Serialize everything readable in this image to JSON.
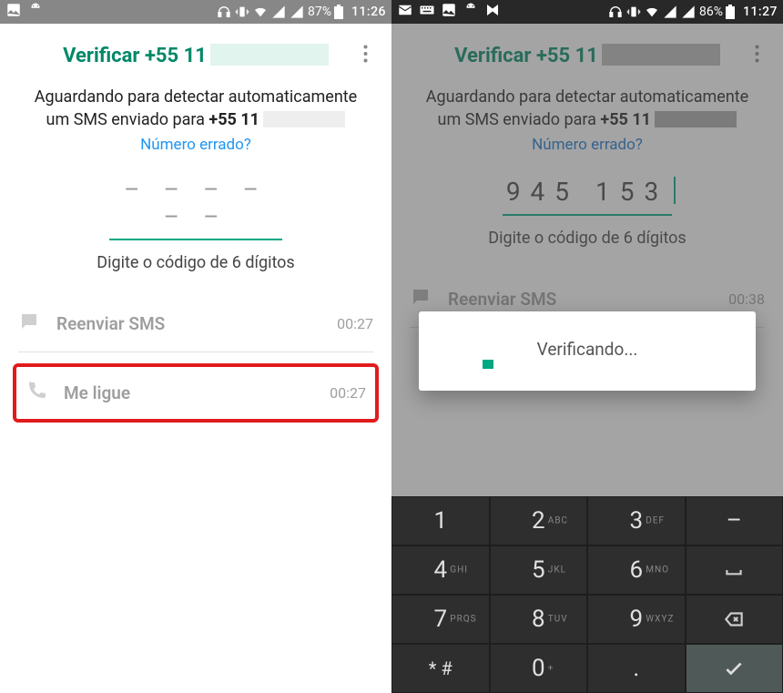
{
  "left": {
    "status": {
      "battery": "87%",
      "time": "11:26"
    },
    "title": "Verificar +55 11",
    "body_l1": "Aguardando para detectar automaticamente",
    "body_l2_pre": "um SMS enviado para ",
    "body_l2_bold": "+55 11",
    "wrong_number": "Número errado?",
    "code_placeholder": "– – –  – – –",
    "code_hint": "Digite o código de 6 dígitos",
    "resend_label": "Reenviar SMS",
    "resend_time": "00:27",
    "call_label": "Me ligue",
    "call_time": "00:27"
  },
  "right": {
    "status": {
      "battery": "86%",
      "time": "11:27"
    },
    "title": "Verificar +55 11",
    "body_l1": "Aguardando para detectar automaticamente",
    "body_l2_pre": "um SMS enviado para ",
    "body_l2_bold": "+55 11",
    "wrong_number": "Número errado?",
    "code_value": "945 153",
    "code_hint": "Digite o código de 6 dígitos",
    "resend_label": "Reenviar SMS",
    "resend_time": "00:38",
    "dialog_text": "Verificando..."
  },
  "keyboard": {
    "keys": [
      {
        "num": "1",
        "sub": ""
      },
      {
        "num": "2",
        "sub": "ABC"
      },
      {
        "num": "3",
        "sub": "DEF"
      },
      {
        "num": "–",
        "sub": ""
      },
      {
        "num": "4",
        "sub": "GHI"
      },
      {
        "num": "5",
        "sub": "JKL"
      },
      {
        "num": "6",
        "sub": "MNO"
      },
      {
        "num": "␣",
        "sub": ""
      },
      {
        "num": "7",
        "sub": "PRQS"
      },
      {
        "num": "8",
        "sub": "TUV"
      },
      {
        "num": "9",
        "sub": "WXYZ"
      },
      {
        "num": "⌫",
        "sub": ""
      },
      {
        "num": "* #",
        "sub": ""
      },
      {
        "num": "0",
        "sub": "+"
      },
      {
        "num": ".",
        "sub": ""
      },
      {
        "num": "✓",
        "sub": ""
      }
    ]
  }
}
